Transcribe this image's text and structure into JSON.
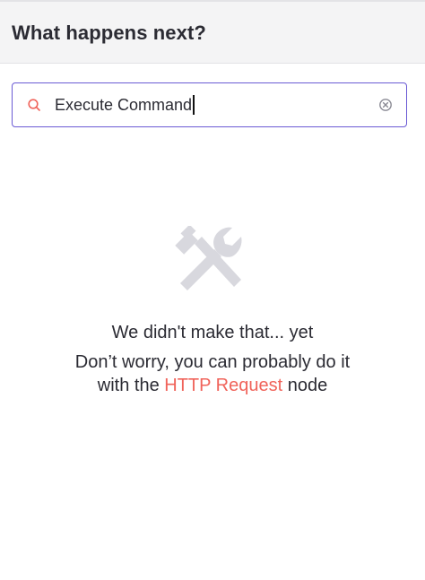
{
  "header": {
    "title": "What happens next?"
  },
  "search": {
    "value": "Execute Command",
    "search_icon": "search-icon",
    "clear_icon": "clear-circle-icon"
  },
  "empty_state": {
    "icon": "tools-icon",
    "title": "We didn't make that... yet",
    "line1": "Don’t worry, you can probably do it",
    "line2_prefix": "with the",
    "link_text": "HTTP Request",
    "line2_suffix": "node"
  },
  "colors": {
    "accent": "#6a5ad4",
    "link": "#f0635a",
    "icon_gray": "#d8d8de",
    "header_bg": "#f4f4f5"
  }
}
